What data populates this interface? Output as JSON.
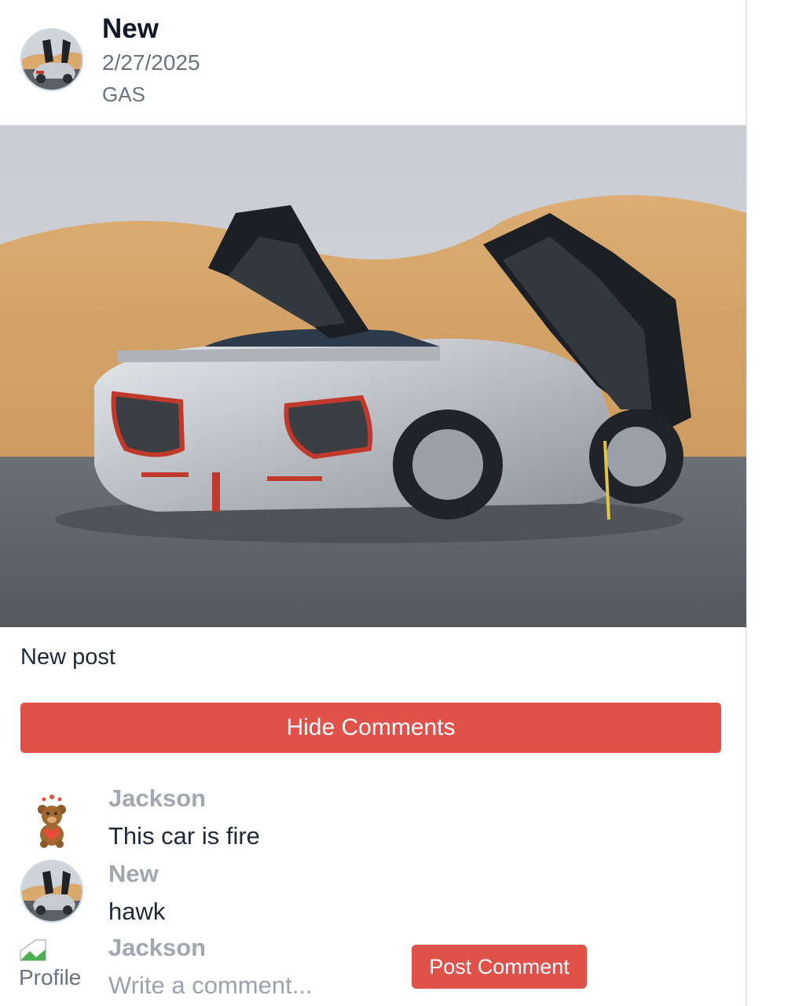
{
  "post": {
    "author": "New",
    "date": "2/27/2025",
    "fuel_type": "GAS",
    "caption": "New post",
    "image_icon": "car-photo"
  },
  "comments_toggle": {
    "label": "Hide Comments"
  },
  "comments": [
    {
      "author": "Jackson",
      "text": "This car is fire",
      "avatar_icon": "teddy-bear-avatar"
    },
    {
      "author": "New",
      "text": "hawk",
      "avatar_icon": "car-avatar"
    }
  ],
  "new_comment": {
    "author": "Jackson",
    "avatar_alt": "Profile",
    "placeholder": "Write a comment...",
    "submit_label": "Post Comment"
  },
  "colors": {
    "accent": "#e0514a",
    "author_muted": "#a3a7b0",
    "text": "#1f2937"
  }
}
